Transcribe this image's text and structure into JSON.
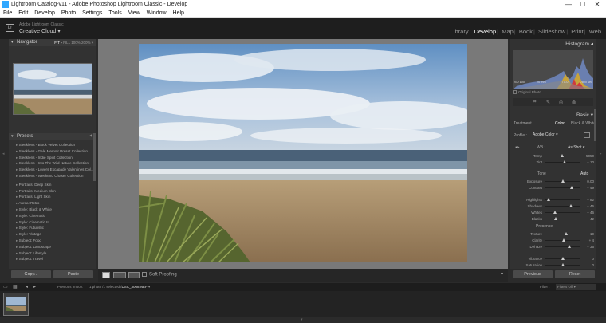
{
  "window": {
    "title": "Lightroom Catalog-v11 - Adobe Photoshop Lightroom Classic - Develop",
    "controls": [
      "—",
      "☐",
      "✕"
    ]
  },
  "menu": [
    "File",
    "Edit",
    "Develop",
    "Photo",
    "Settings",
    "Tools",
    "View",
    "Window",
    "Help"
  ],
  "identity": {
    "line1": "Adobe Lightroom Classic",
    "line2": "Creative Cloud",
    "logo": "Lr"
  },
  "modules": [
    "Library",
    "Develop",
    "Map",
    "Book",
    "Slideshow",
    "Print",
    "Web"
  ],
  "active_module": "Develop",
  "navigator": {
    "title": "Navigator",
    "zoom_options": [
      "FIT",
      "FILL",
      "100%",
      "200%"
    ]
  },
  "presets": {
    "title": "Presets",
    "group1": [
      "Sleeklens - Block Velvet Collection",
      "Sleeklens - Gale Memoir Preset Collection",
      "Sleeklens - Indie Spirit Collection",
      "Sleeklens - Into The Wild Nature Collection",
      "Sleeklens - Lovers Escapade Valentines Col...",
      "Sleeklens - Weekend Chaser Collection"
    ],
    "group2": [
      "Portraits: Deep Skin",
      "Portraits: Medium Skin",
      "Portraits: Light Skin",
      "Aurea: Retro",
      "Style: Black & White",
      "Style: Cinematic",
      "Style: Cinematic II",
      "Style: Futuristic",
      "Style: Vintage",
      "Subject: Food",
      "Subject: Landscape",
      "Subject: Lifestyle",
      "Subject: Travel"
    ]
  },
  "left_buttons": {
    "copy": "Copy...",
    "paste": "Paste"
  },
  "toolbar": {
    "soft_proofing": "Soft Proofing"
  },
  "histogram": {
    "title": "Histogram",
    "iso": "ISO 100",
    "focal": "20 mm",
    "aperture": "f / 8.0",
    "shutter": "1/800 sec",
    "original_photo": "Original Photo"
  },
  "basic": {
    "title": "Basic",
    "treatment_label": "Treatment :",
    "treatment_color": "Color",
    "treatment_bw": "Black & White",
    "profile_label": "Profile :",
    "profile_value": "Adobe Color",
    "wb_label": "WB :",
    "wb_value": "As Shot",
    "tone_label": "Tone",
    "auto_label": "Auto",
    "presence_label": "Presence",
    "sliders": [
      {
        "label": "Temp",
        "value": "5050",
        "pos": 0.48
      },
      {
        "label": "Tint",
        "value": "+ 10",
        "pos": 0.55
      },
      {
        "label": "Exposure",
        "value": "0.00",
        "pos": 0.5
      },
      {
        "label": "Contrast",
        "value": "+ 49",
        "pos": 0.74
      },
      {
        "label": "Highlights",
        "value": "− 82",
        "pos": 0.09
      },
      {
        "label": "Shadows",
        "value": "+ 46",
        "pos": 0.73
      },
      {
        "label": "Whites",
        "value": "− 46",
        "pos": 0.27
      },
      {
        "label": "Blacks",
        "value": "− 42",
        "pos": 0.29
      },
      {
        "label": "Texture",
        "value": "+ 19",
        "pos": 0.6
      },
      {
        "label": "Clarity",
        "value": "+ 4",
        "pos": 0.52
      },
      {
        "label": "Dehaze",
        "value": "+ 35",
        "pos": 0.68
      },
      {
        "label": "Vibrance",
        "value": "0",
        "pos": 0.5
      },
      {
        "label": "Saturation",
        "value": "0",
        "pos": 0.5
      }
    ]
  },
  "right_buttons": {
    "previous": "Previous",
    "reset": "Reset"
  },
  "filmstrip": {
    "source": "Previous Import",
    "info": "1 photo /1 selected /",
    "filename": "DSC_3068.NEF",
    "filter_label": "Filter :",
    "filter_value": "Filters Off"
  },
  "colors": {
    "background": "#2b2b2b",
    "panel": "#323232",
    "active_text": "#ffffff"
  }
}
